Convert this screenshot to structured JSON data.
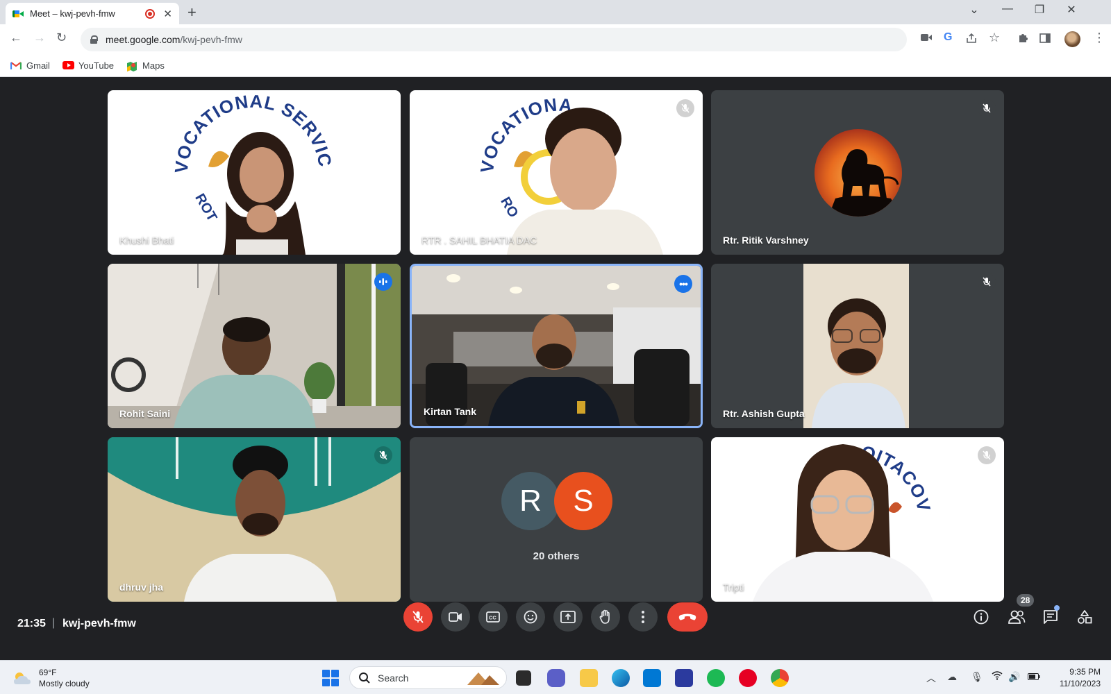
{
  "browser": {
    "tab_title": "Meet – kwj-pevh-fmw",
    "tab_close": "✕",
    "new_tab": "+",
    "url_host": "meet.google.com",
    "url_path": "/kwj-pevh-fmw",
    "bookmarks": [
      {
        "label": "Gmail",
        "icon": "gmail-icon"
      },
      {
        "label": "YouTube",
        "icon": "youtube-icon"
      },
      {
        "label": "Maps",
        "icon": "maps-icon"
      }
    ]
  },
  "meet": {
    "tiles": [
      {
        "name": "Khushi Bhati",
        "muted": false
      },
      {
        "name": "RTR . SAHIL BHATIA DAC",
        "muted": true
      },
      {
        "name": "Rtr. Ritik Varshney",
        "muted": true
      },
      {
        "name": "Rohit Saini",
        "speaking_indicator": true
      },
      {
        "name": "Kirtan Tank",
        "speaking": true
      },
      {
        "name": "Rtr. Ashish Gupta",
        "muted": true
      },
      {
        "name": "dhruv jha",
        "muted": true
      },
      {
        "name": "20 others",
        "initials": [
          "R",
          "S"
        ]
      },
      {
        "name": "Tripti",
        "muted": true
      }
    ],
    "logo_text": "VOCATIONAL SERVICES",
    "logo_text_partial": "VOCATIONA",
    "logo_small": "ROT",
    "logo_small_2": "RO",
    "logo_mirror": "OITACOV",
    "meeting_time": "21:35",
    "separator": "|",
    "meeting_code": "kwj-pevh-fmw",
    "participant_count": "28",
    "colors": {
      "accent": "#1a73e8",
      "end_call": "#ea4335",
      "bg": "#202124",
      "tile": "#3c4043"
    }
  },
  "taskbar": {
    "temperature": "69°F",
    "weather": "Mostly cloudy",
    "search_label": "Search",
    "time": "9:35 PM",
    "date": "11/10/2023"
  }
}
